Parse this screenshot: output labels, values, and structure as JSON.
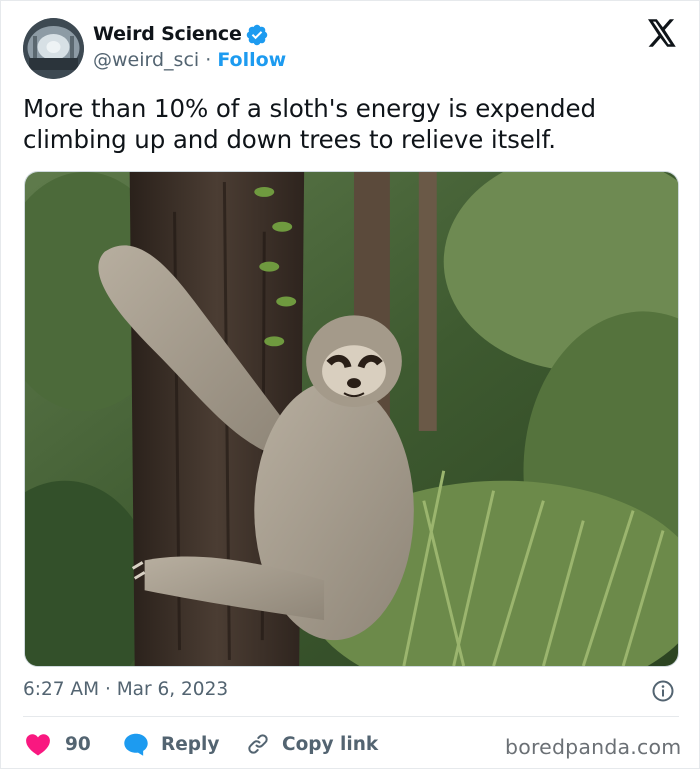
{
  "author": {
    "name": "Weird Science",
    "handle": "@weird_sci",
    "separator": "·",
    "follow_label": "Follow",
    "verified": true
  },
  "tweet": {
    "text": "More than 10% of a sloth's energy is expended climbing up and down trees to relieve itself.",
    "media_description": "sloth hugging a tree trunk in a forest",
    "time": "6:27 AM",
    "separator": "·",
    "date": "Mar 6, 2023"
  },
  "actions": {
    "like_count": "90",
    "reply_label": "Reply",
    "copy_link_label": "Copy link"
  },
  "watermark": "boredpanda.com",
  "colors": {
    "accent": "#1d9bf0",
    "like": "#f91880",
    "reply": "#1d9bf0",
    "secondary_text": "#536471"
  },
  "icons": [
    "verified-badge-icon",
    "x-logo-icon",
    "info-icon",
    "heart-icon",
    "reply-bubble-icon",
    "link-icon"
  ]
}
